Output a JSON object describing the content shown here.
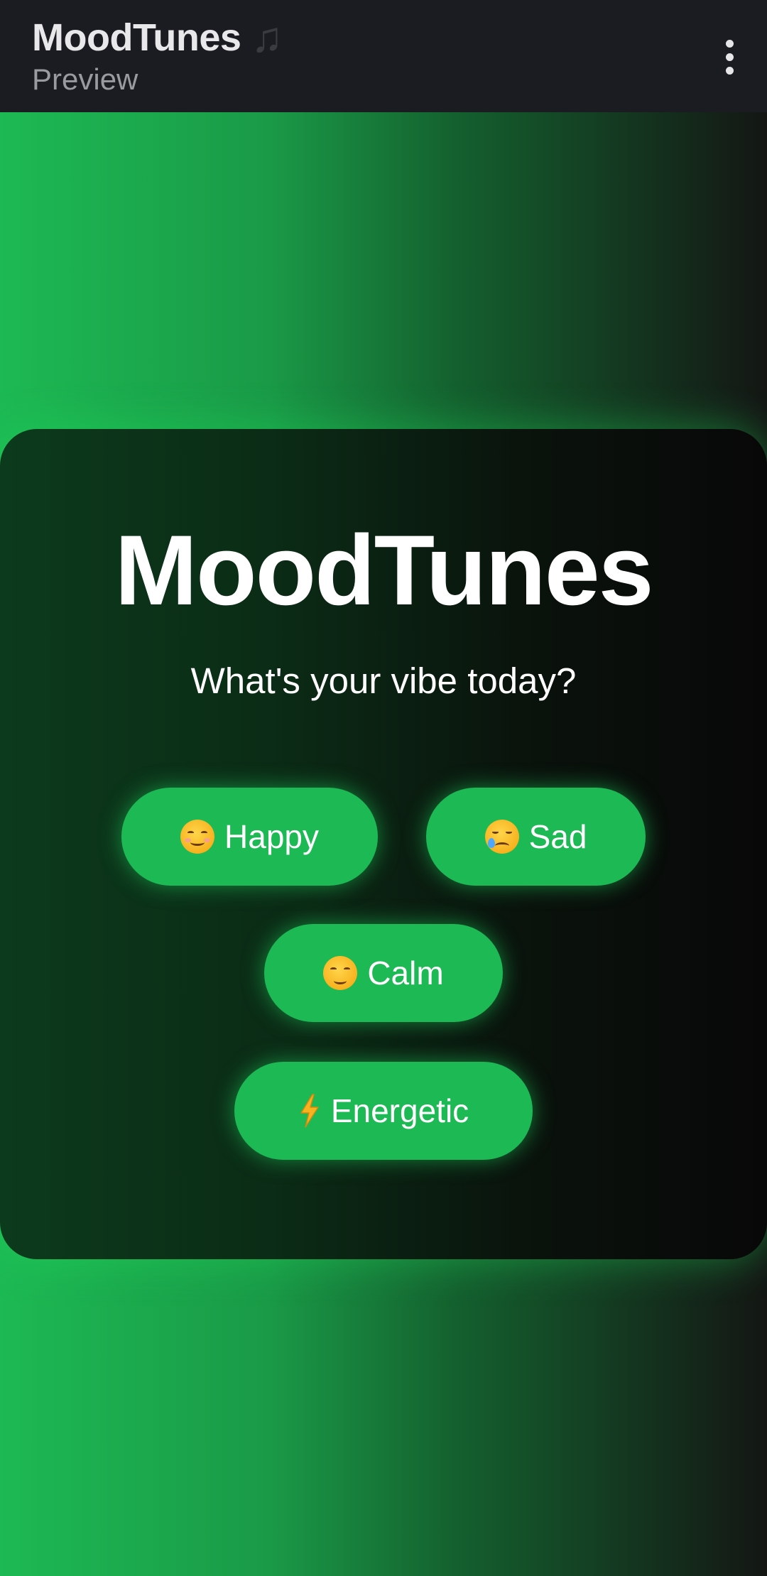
{
  "app_bar": {
    "title": "MoodTunes",
    "title_icon": "music-note-icon",
    "subtitle": "Preview",
    "menu_icon": "more-vertical-icon"
  },
  "card": {
    "title": "MoodTunes",
    "subtitle": "What's your vibe today?"
  },
  "moods": [
    {
      "label": "Happy",
      "icon": "smiling-face-icon"
    },
    {
      "label": "Sad",
      "icon": "crying-face-icon"
    },
    {
      "label": "Calm",
      "icon": "relieved-face-icon"
    },
    {
      "label": "Energetic",
      "icon": "lightning-bolt-icon"
    }
  ],
  "colors": {
    "accent": "#1db954",
    "app_bar_bg": "#1b1c21",
    "card_bg": "#0b2c16",
    "text": "#ffffff"
  }
}
